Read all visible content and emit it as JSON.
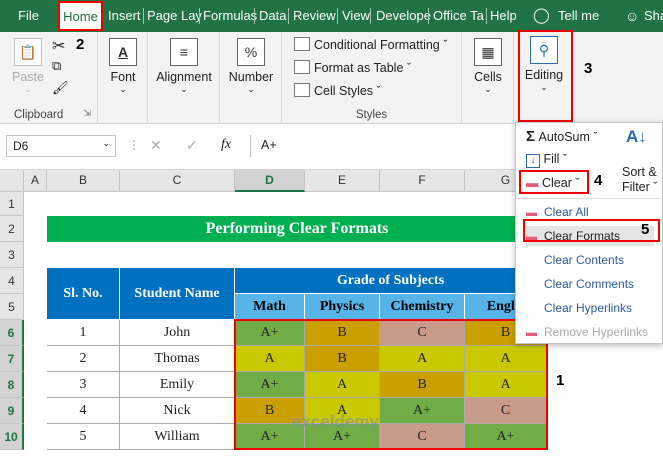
{
  "menu": {
    "tabs": [
      "File",
      "Home",
      "Insert",
      "Page Lay",
      "Formulas",
      "Data",
      "Review",
      "View",
      "Develope",
      "Office Ta",
      "Help"
    ],
    "tell_me": "Tell me",
    "share": "Sha"
  },
  "ribbon": {
    "clipboard": {
      "paste": "Paste",
      "label": "Clipboard"
    },
    "font": {
      "label": "Font"
    },
    "alignment": {
      "label": "Alignment"
    },
    "number": {
      "label": "Number"
    },
    "styles": {
      "conditional": "Conditional Formatting",
      "format_table": "Format as Table",
      "cell_styles": "Cell Styles",
      "label": "Styles"
    },
    "cells": {
      "label": "Cells"
    },
    "editing": {
      "label": "Editing"
    }
  },
  "annotations": {
    "a1": "1",
    "a2": "2",
    "a3": "3",
    "a4": "4",
    "a5": "5"
  },
  "formula_bar": {
    "name_box": "D6",
    "fx": "fx",
    "value": "A+"
  },
  "columns": [
    "A",
    "B",
    "C",
    "D",
    "E",
    "F",
    "G"
  ],
  "rows": [
    "1",
    "2",
    "3",
    "4",
    "5",
    "6",
    "7",
    "8",
    "9",
    "10"
  ],
  "sheet": {
    "title": "Performing Clear Formats",
    "header_slno": "Sl. No.",
    "header_name": "Student Name",
    "header_grade": "Grade of Subjects",
    "subjects": [
      "Math",
      "Physics",
      "Chemistry",
      "Englis"
    ],
    "records": [
      {
        "no": "1",
        "name": "John",
        "grades": [
          "A+",
          "B",
          "C",
          "B"
        ]
      },
      {
        "no": "2",
        "name": "Thomas",
        "grades": [
          "A",
          "B",
          "A",
          "A"
        ]
      },
      {
        "no": "3",
        "name": "Emily",
        "grades": [
          "A+",
          "A",
          "B",
          "A"
        ]
      },
      {
        "no": "4",
        "name": "Nick",
        "grades": [
          "B",
          "A",
          "A+",
          "C"
        ]
      },
      {
        "no": "5",
        "name": "William",
        "grades": [
          "A+",
          "A+",
          "C",
          "A+"
        ]
      }
    ]
  },
  "colors": {
    "A+": "#70ad47",
    "A": "#c9c900",
    "B": "#c9a000",
    "C": "#c9998a",
    "excel_green": "#217346",
    "header_blue": "#0070c0",
    "title_green": "#00b050"
  },
  "dropdown": {
    "autosum": "AutoSum",
    "fill": "Fill",
    "clear": "Clear",
    "sort_filter_1": "Sort &",
    "sort_filter_2": "Filter",
    "items": [
      "Clear All",
      "Clear Formats",
      "Clear Contents",
      "Clear Comments",
      "Clear Hyperlinks",
      "Remove Hyperlinks"
    ]
  },
  "watermark": "exceldemy"
}
